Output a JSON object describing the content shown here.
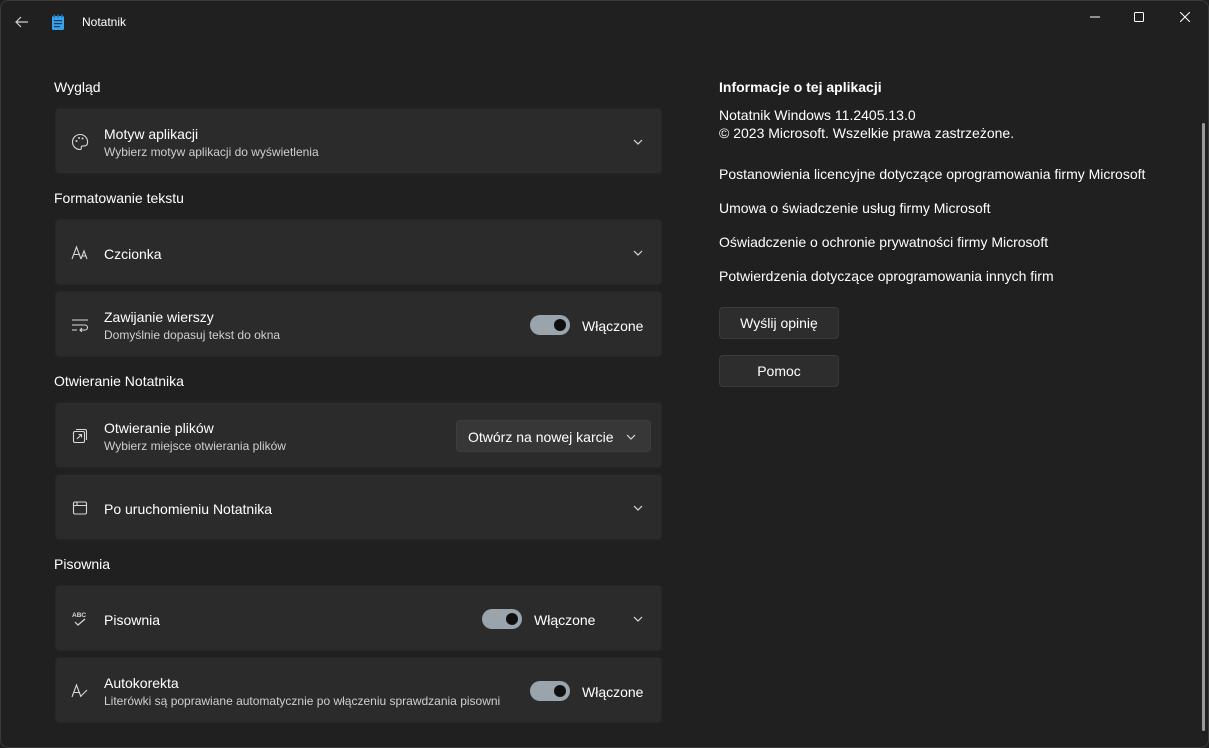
{
  "window": {
    "title": "Notatnik",
    "icons": {
      "back": "arrow-left-icon",
      "app": "notepad-icon",
      "minimize": "minimize-icon",
      "maximize": "maximize-icon",
      "close": "close-icon"
    }
  },
  "sections": {
    "appearance": {
      "title": "Wygląd",
      "theme": {
        "title": "Motyw aplikacji",
        "description": "Wybierz motyw aplikacji do wyświetlenia",
        "icon": "palette-icon"
      }
    },
    "text_formatting": {
      "title": "Formatowanie tekstu",
      "font": {
        "title": "Czcionka",
        "icon": "font-icon"
      },
      "word_wrap": {
        "title": "Zawijanie wierszy",
        "description": "Domyślnie dopasuj tekst do okna",
        "toggle_label": "Włączone",
        "enabled": true,
        "icon": "word-wrap-icon"
      }
    },
    "opening": {
      "title": "Otwieranie Notatnika",
      "opening_files": {
        "title": "Otwieranie plików",
        "description": "Wybierz miejsce otwierania plików",
        "selected": "Otwórz na nowej karcie",
        "icon": "open-file-icon"
      },
      "on_startup": {
        "title": "Po uruchomieniu Notatnika",
        "icon": "window-icon"
      }
    },
    "spelling": {
      "title": "Pisownia",
      "spellcheck": {
        "title": "Pisownia",
        "toggle_label": "Włączone",
        "enabled": true,
        "icon": "spellcheck-icon"
      },
      "autocorrect": {
        "title": "Autokorekta",
        "description": "Literówki są poprawiane automatycznie po włączeniu sprawdzania pisowni",
        "toggle_label": "Włączone",
        "enabled": true,
        "icon": "autocorrect-icon"
      }
    }
  },
  "about": {
    "title": "Informacje o tej aplikacji",
    "version": "Notatnik Windows 11.2405.13.0",
    "copyright": "© 2023 Microsoft. Wszelkie prawa zastrzeżone.",
    "links": [
      "Postanowienia licencyjne dotyczące oprogramowania firmy Microsoft",
      "Umowa o świadczenie usług firmy Microsoft",
      "Oświadczenie o ochronie prywatności firmy Microsoft",
      "Potwierdzenia dotyczące oprogramowania innych firm"
    ],
    "feedback_button": "Wyślij opinię",
    "help_button": "Pomoc"
  },
  "colors": {
    "background": "#202020",
    "card": "#2b2b2b",
    "toggle_on": "#9aa4ad"
  }
}
